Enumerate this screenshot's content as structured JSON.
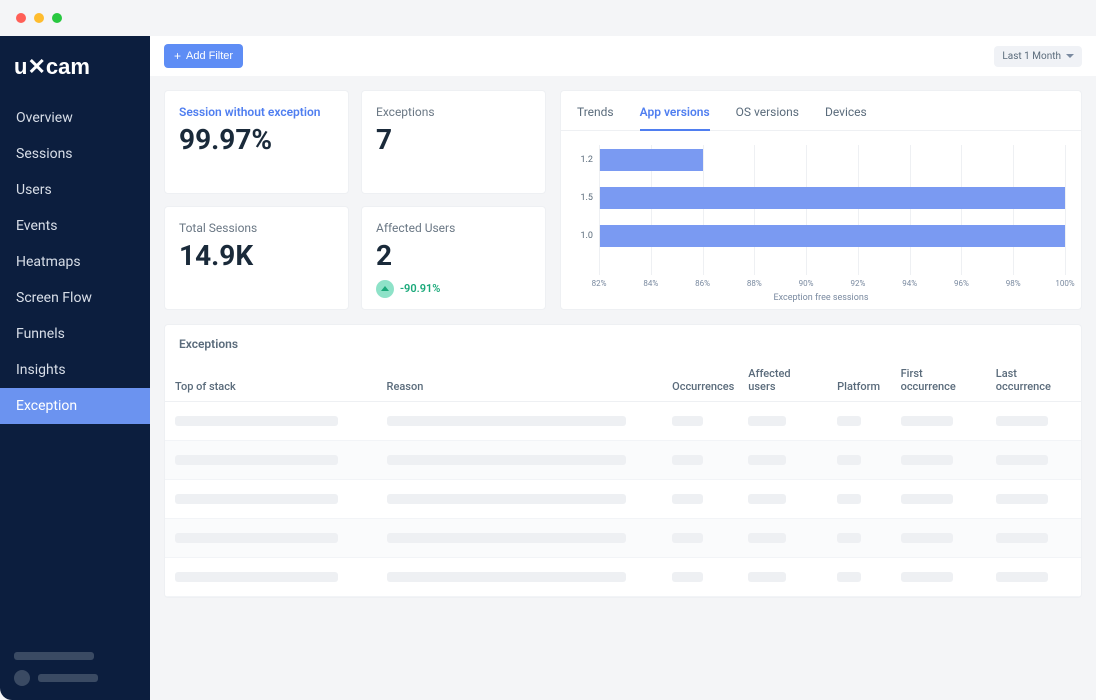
{
  "brand": "uxcam",
  "sidebar": {
    "items": [
      {
        "label": "Overview"
      },
      {
        "label": "Sessions"
      },
      {
        "label": "Users"
      },
      {
        "label": "Events"
      },
      {
        "label": "Heatmaps"
      },
      {
        "label": "Screen Flow"
      },
      {
        "label": "Funnels"
      },
      {
        "label": "Insights"
      },
      {
        "label": "Exception"
      }
    ],
    "active_index": 8
  },
  "toolbar": {
    "add_filter_label": "Add Filter",
    "date_range_label": "Last 1 Month"
  },
  "cards": {
    "session_no_exception": {
      "title": "Session without exception",
      "value": "99.97%"
    },
    "exceptions": {
      "title": "Exceptions",
      "value": "7"
    },
    "total_sessions": {
      "title": "Total Sessions",
      "value": "14.9K"
    },
    "affected_users": {
      "title": "Affected Users",
      "value": "2",
      "trend": "-90.91%"
    }
  },
  "chart_tabs": {
    "items": [
      {
        "label": "Trends"
      },
      {
        "label": "App versions"
      },
      {
        "label": "OS versions"
      },
      {
        "label": "Devices"
      }
    ],
    "active_index": 1
  },
  "chart_data": {
    "type": "bar",
    "orientation": "horizontal",
    "categories": [
      "1.2",
      "1.5",
      "1.0"
    ],
    "values": [
      86,
      100,
      100
    ],
    "xlabel": "Exception free sessions",
    "ylabel": "",
    "xlim": [
      82,
      100
    ],
    "x_ticks": [
      82,
      84,
      86,
      88,
      90,
      92,
      94,
      96,
      98,
      100
    ],
    "x_tick_labels": [
      "82%",
      "84%",
      "86%",
      "88%",
      "90%",
      "92%",
      "94%",
      "96%",
      "98%",
      "100%"
    ]
  },
  "table": {
    "title": "Exceptions",
    "columns": [
      "Top of stack",
      "Reason",
      "Occurrences",
      "Affected users",
      "Platform",
      "First occurrence",
      "Last occurrence"
    ],
    "row_count": 5
  }
}
